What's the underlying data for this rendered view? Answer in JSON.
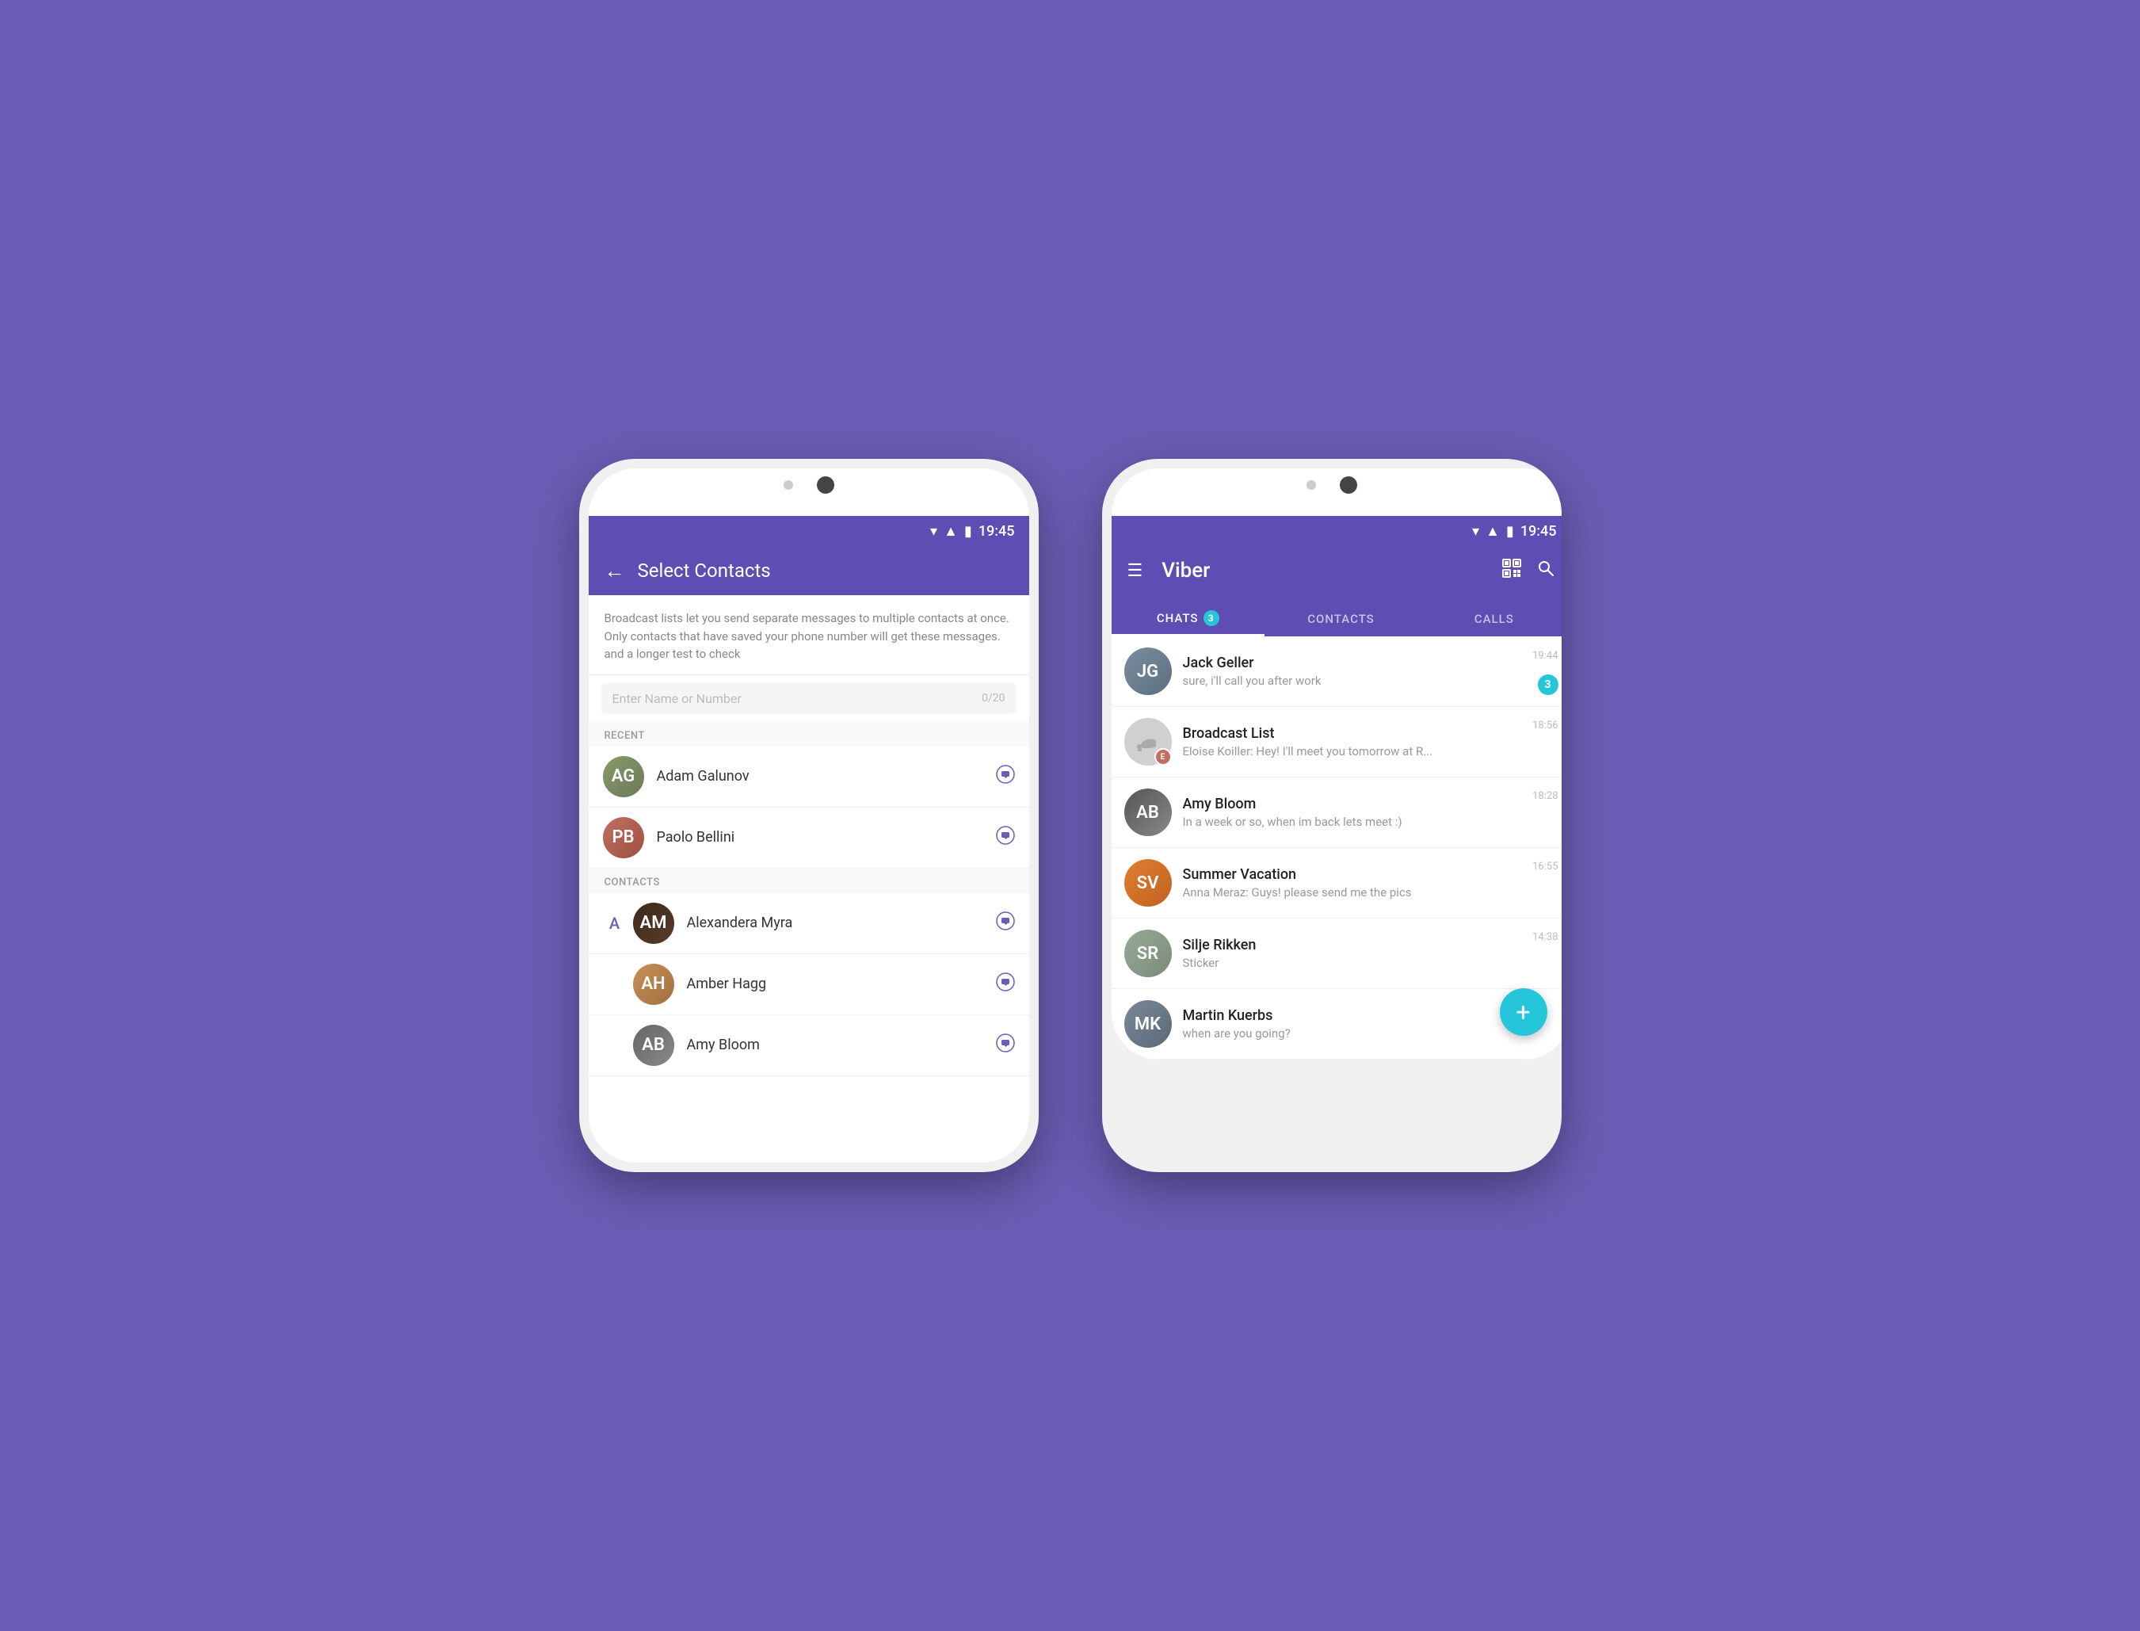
{
  "background_color": "#6b5db5",
  "accent_color": "#5e4db3",
  "teal_color": "#26c6da",
  "phone_left": {
    "status_bar": {
      "time": "19:45",
      "icons": [
        "wifi",
        "signal",
        "battery"
      ]
    },
    "header": {
      "back_label": "←",
      "title": "Select Contacts"
    },
    "description": "Broadcast lists let you send separate messages to multiple contacts at once. Only contacts that have saved your phone number will get these messages. and a longer test to check",
    "search": {
      "placeholder": "Enter Name or Number",
      "counter": "0/20"
    },
    "sections": [
      {
        "label": "RECENT",
        "contacts": [
          {
            "name": "Adam Galunov",
            "has_viber": true,
            "alpha": ""
          },
          {
            "name": "Paolo Bellini",
            "has_viber": true,
            "alpha": ""
          }
        ]
      },
      {
        "label": "CONTACTS",
        "contacts": [
          {
            "name": "Alexandera Myra",
            "has_viber": true,
            "alpha": "A"
          },
          {
            "name": "Amber Hagg",
            "has_viber": true,
            "alpha": ""
          },
          {
            "name": "Amy Bloom",
            "has_viber": true,
            "alpha": ""
          }
        ]
      }
    ]
  },
  "phone_right": {
    "status_bar": {
      "time": "19:45"
    },
    "header": {
      "hamburger": "☰",
      "title": "Viber"
    },
    "tabs": [
      {
        "label": "CHATS",
        "badge": "3",
        "active": true
      },
      {
        "label": "CONTACTS",
        "badge": "",
        "active": false
      },
      {
        "label": "CALLS",
        "badge": "",
        "active": false
      }
    ],
    "chats": [
      {
        "name": "Jack Geller",
        "preview": "sure, i'll call you after work",
        "time": "19:44",
        "unread": "3",
        "avatar_initials": "JG",
        "avatar_color": "#7b8fa0"
      },
      {
        "name": "Broadcast List",
        "preview": "Eloise Koiller: Hey! I'll meet you tomorrow at R...",
        "time": "18:56",
        "unread": "",
        "avatar_initials": "",
        "avatar_color": "#bbb",
        "is_broadcast": true
      },
      {
        "name": "Amy Bloom",
        "preview": "In a week or so, when im back lets meet :)",
        "time": "18:28",
        "unread": "",
        "avatar_initials": "AB",
        "avatar_color": "#8b7355"
      },
      {
        "name": "Summer Vacation",
        "preview": "Anna Meraz: Guys! please send me the pics",
        "time": "16:55",
        "unread": "",
        "avatar_initials": "SV",
        "avatar_color": "#cc8844"
      },
      {
        "name": "Silje Rikken",
        "preview": "Sticker",
        "time": "14:38",
        "unread": "",
        "avatar_initials": "SR",
        "avatar_color": "#9aaa99"
      },
      {
        "name": "Martin Kuerbs",
        "preview": "when are you going?",
        "time": "",
        "unread": "",
        "avatar_initials": "MK",
        "avatar_color": "#7a8898"
      }
    ],
    "fab_label": "+"
  }
}
